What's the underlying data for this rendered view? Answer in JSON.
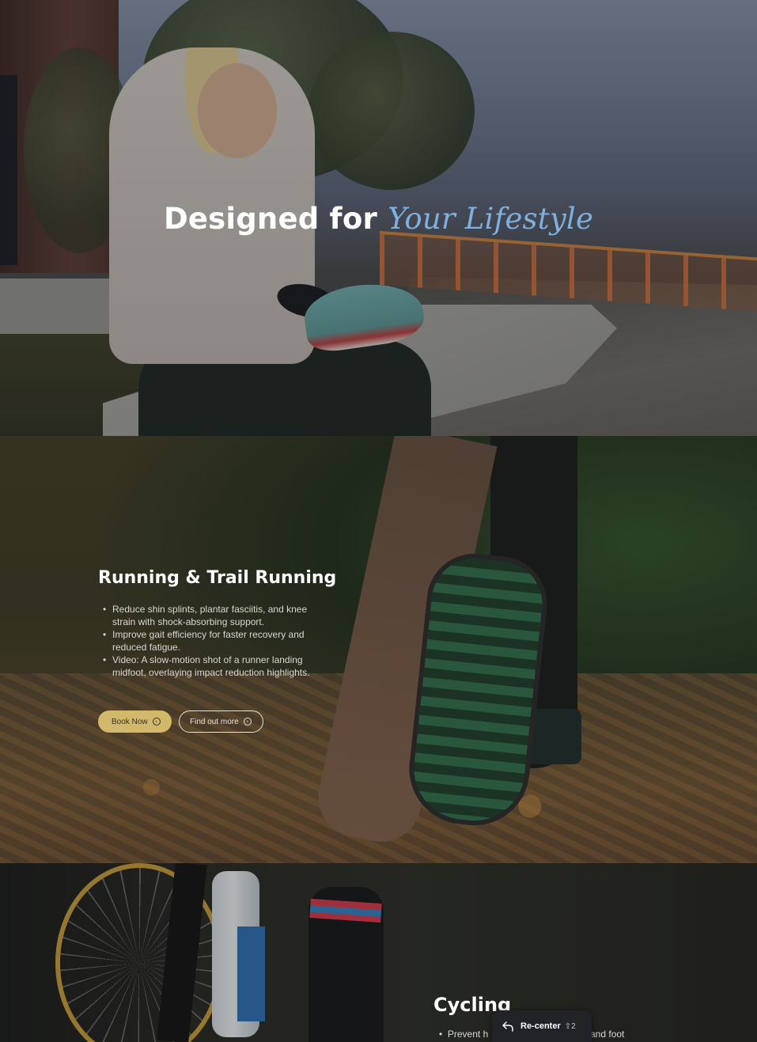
{
  "hero": {
    "title_main": "Designed for",
    "title_accent": "Your Lifestyle"
  },
  "running": {
    "title": "Running & Trail Running",
    "bullets": [
      "Reduce shin splints, plantar fasciitis, and knee strain with shock-absorbing support.",
      "Improve gait efficiency for faster recovery and reduced fatigue.",
      "Video: A slow-motion shot of a runner landing midfoot, overlaying impact reduction highlights."
    ],
    "book_label": "Book Now",
    "more_label": "Find out more"
  },
  "cycling": {
    "title": "Cycling",
    "bullet_left_visible": "Prevent h",
    "bullet_right_visible": "and foot"
  },
  "recenter": {
    "label": "Re-center",
    "shortcut": "⇧2"
  },
  "colors": {
    "accent_blue": "#7fb0e0",
    "book_button": "#d1b86a"
  }
}
